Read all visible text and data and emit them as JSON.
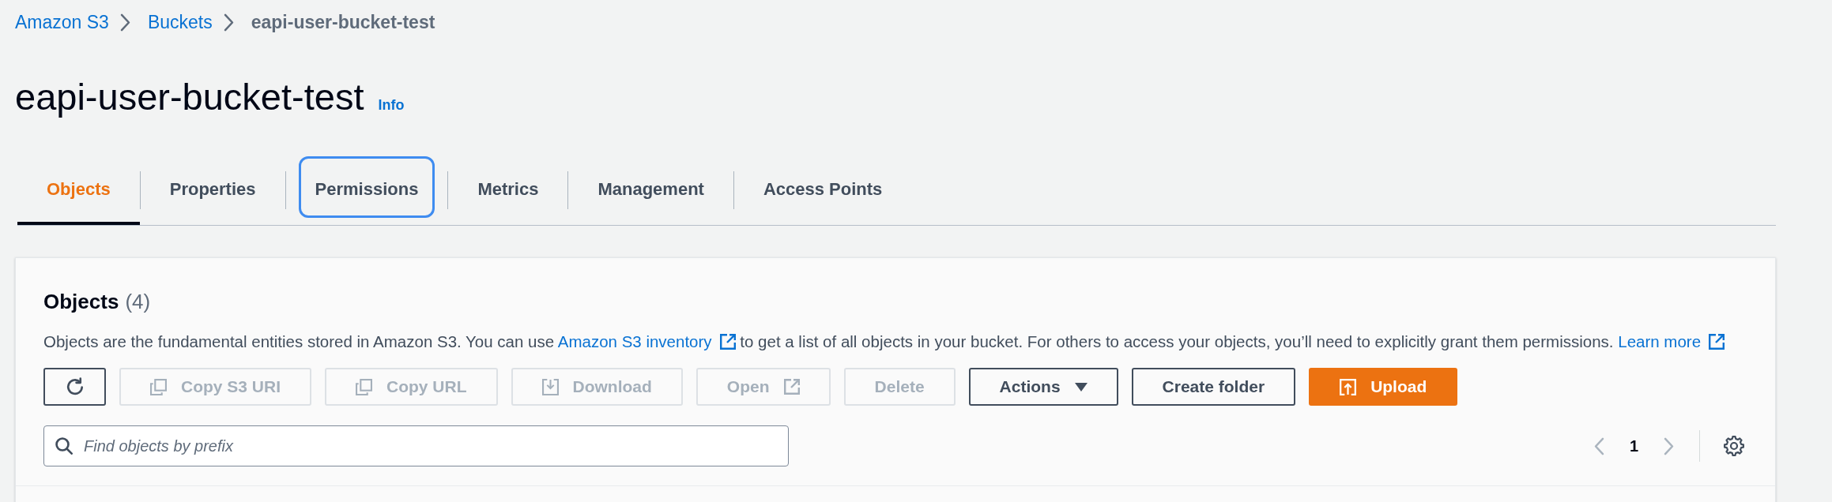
{
  "breadcrumbs": [
    {
      "label": "Amazon S3",
      "kind": "link"
    },
    {
      "label": "Buckets",
      "kind": "link"
    },
    {
      "label": "eapi-user-bucket-test",
      "kind": "current"
    }
  ],
  "header": {
    "title": "eapi-user-bucket-test",
    "info_link": "Info"
  },
  "tabs": [
    {
      "label": "Objects",
      "selected": true,
      "focused": false
    },
    {
      "label": "Properties",
      "selected": false,
      "focused": false
    },
    {
      "label": "Permissions",
      "selected": false,
      "focused": true
    },
    {
      "label": "Metrics",
      "selected": false,
      "focused": false
    },
    {
      "label": "Management",
      "selected": false,
      "focused": false
    },
    {
      "label": "Access Points",
      "selected": false,
      "focused": false
    }
  ],
  "objects_panel": {
    "heading": "Objects",
    "count": "(4)",
    "description": [
      {
        "kind": "text",
        "text": "Objects are the fundamental entities stored in Amazon S3. You can use "
      },
      {
        "kind": "external_link",
        "text": "Amazon S3 inventory"
      },
      {
        "kind": "text",
        "text": " to get a list of all objects in your bucket. For others to access your objects, you’ll need to explicitly grant them permissions. "
      },
      {
        "kind": "external_link",
        "text": "Learn more"
      }
    ],
    "toolbar": [
      {
        "kind": "refresh",
        "disabled": false,
        "primary": false
      },
      {
        "kind": "copy",
        "label": "Copy S3 URI",
        "disabled": true,
        "primary": false
      },
      {
        "kind": "copy",
        "label": "Copy URL",
        "disabled": true,
        "primary": false
      },
      {
        "kind": "download",
        "label": "Download",
        "disabled": true,
        "primary": false
      },
      {
        "kind": "open",
        "label": "Open",
        "disabled": true,
        "primary": false
      },
      {
        "kind": "plain",
        "label": "Delete",
        "disabled": true,
        "primary": false
      },
      {
        "kind": "dropdown",
        "label": "Actions",
        "disabled": false,
        "primary": false
      },
      {
        "kind": "plain",
        "label": "Create folder",
        "disabled": false,
        "primary": false
      },
      {
        "kind": "upload",
        "label": "Upload",
        "disabled": false,
        "primary": true
      }
    ],
    "search": {
      "placeholder": "Find objects by prefix"
    },
    "pagination": {
      "previous": {
        "disabled": true
      },
      "pages": [
        {
          "label": "1",
          "selected": true
        }
      ],
      "next": {
        "disabled": true
      }
    }
  }
}
